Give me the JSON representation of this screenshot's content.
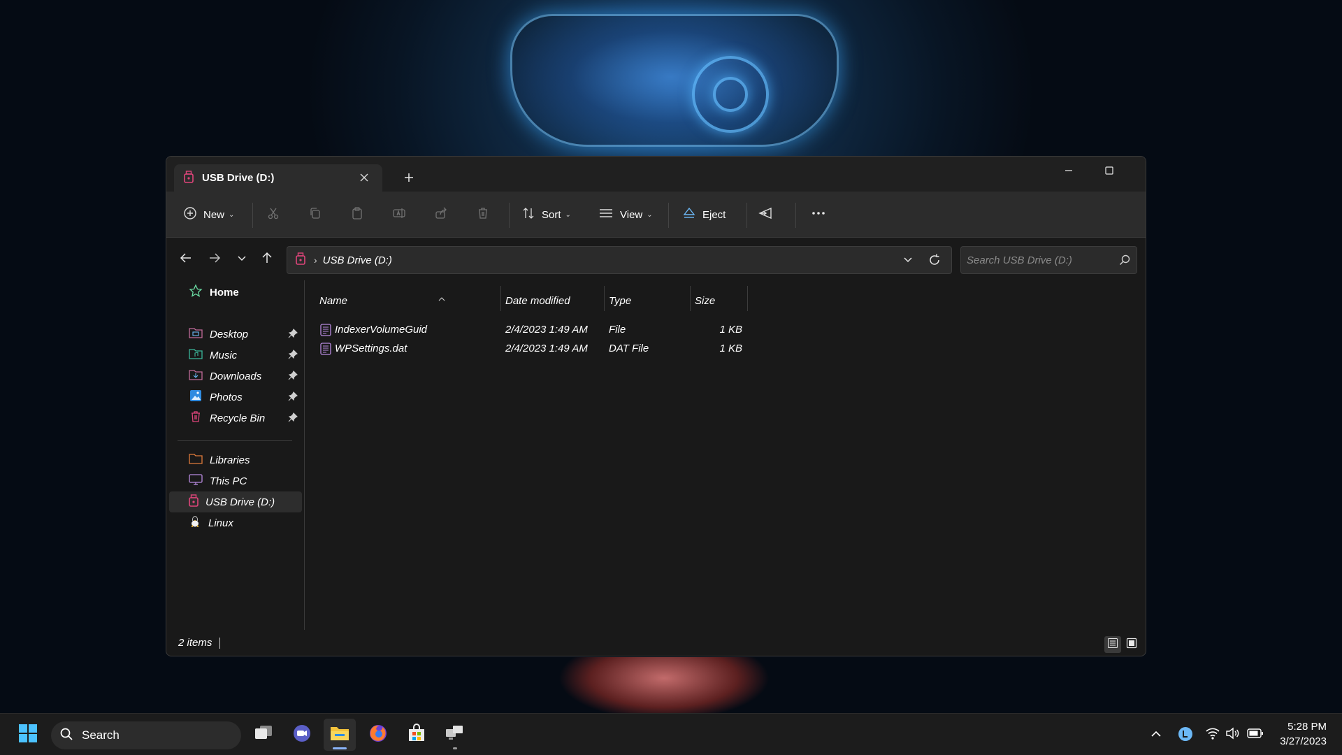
{
  "window": {
    "tab_title": "USB Drive (D:)",
    "controls": {
      "minimize": "minimize",
      "maximize": "maximize",
      "close": "close"
    }
  },
  "toolbar": {
    "new_label": "New",
    "sort_label": "Sort",
    "view_label": "View",
    "eject_label": "Eject",
    "disabled_actions": [
      "cut",
      "copy",
      "paste",
      "rename",
      "share",
      "delete"
    ]
  },
  "address": {
    "path": "USB Drive (D:)"
  },
  "search": {
    "placeholder": "Search USB Drive (D:)"
  },
  "sidebar": {
    "home": "Home",
    "pinned": [
      {
        "label": "Desktop",
        "icon": "desktop-folder-icon"
      },
      {
        "label": "Music",
        "icon": "music-folder-icon"
      },
      {
        "label": "Downloads",
        "icon": "downloads-folder-icon"
      },
      {
        "label": "Photos",
        "icon": "photos-icon"
      },
      {
        "label": "Recycle Bin",
        "icon": "recycle-bin-icon"
      }
    ],
    "locations": [
      {
        "label": "Libraries",
        "icon": "libraries-icon"
      },
      {
        "label": "This PC",
        "icon": "this-pc-icon"
      },
      {
        "label": "USB Drive (D:)",
        "icon": "usb-drive-icon",
        "selected": true
      },
      {
        "label": "Linux",
        "icon": "linux-icon"
      }
    ]
  },
  "file_list": {
    "columns": [
      "Name",
      "Date modified",
      "Type",
      "Size"
    ],
    "rows": [
      {
        "name": "IndexerVolumeGuid",
        "date": "2/4/2023 1:49 AM",
        "type": "File",
        "size": "1 KB"
      },
      {
        "name": "WPSettings.dat",
        "date": "2/4/2023 1:49 AM",
        "type": "DAT File",
        "size": "1 KB"
      }
    ]
  },
  "status": {
    "items_count": "2 items"
  },
  "taskbar": {
    "search_label": "Search",
    "clock_time": "5:28 PM",
    "clock_date": "3/27/2023"
  },
  "colors": {
    "window_bg": "#191919",
    "toolbar_bg": "#2c2c2c",
    "usb_accent": "#e0457b",
    "taskbar_bg": "#1c1c1c"
  }
}
